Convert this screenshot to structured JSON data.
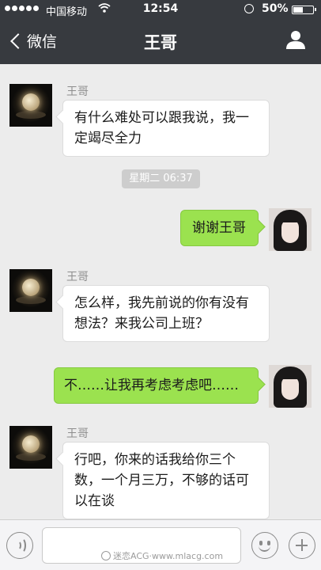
{
  "status_bar": {
    "carrier": "中国移动",
    "time": "12:54",
    "battery_percent": "50%",
    "battery_level": 0.5
  },
  "nav": {
    "back_label": "微信",
    "title": "王哥"
  },
  "messages": [
    {
      "side": "left",
      "sender": "王哥",
      "text": "有什么难处可以跟我说，我一定竭尽全力"
    },
    {
      "type": "timestamp",
      "text": "星期二 06:37"
    },
    {
      "side": "right",
      "text": "谢谢王哥"
    },
    {
      "side": "left",
      "sender": "王哥",
      "text": "怎么样，我先前说的你有没有想法？来我公司上班？"
    },
    {
      "side": "right",
      "text": "不……让我再考虑考虑吧……"
    },
    {
      "side": "left",
      "sender": "王哥",
      "text": "行吧，你来的话我给你三个数，一个月三万，不够的话可以在谈"
    }
  ],
  "input": {
    "watermark": "迷恋ACG·www.mlacg.com"
  },
  "icons": [
    "back-chevron-icon",
    "profile-icon",
    "voice-icon",
    "emoji-icon",
    "plus-icon",
    "wifi-icon",
    "lock-rotation-icon",
    "battery-icon"
  ]
}
